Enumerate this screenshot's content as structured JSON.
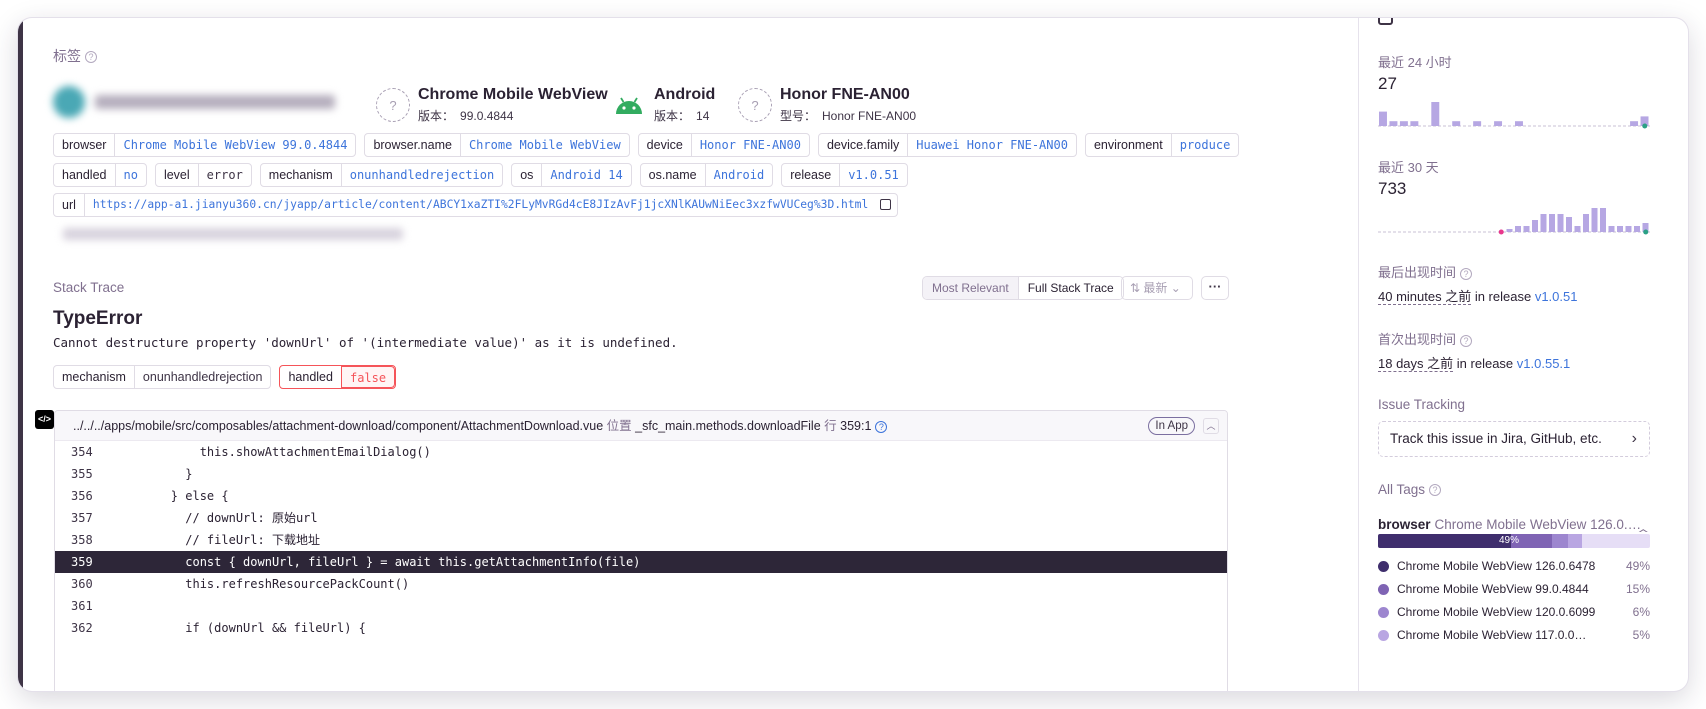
{
  "tags_section": {
    "title": "标签",
    "context": [
      {
        "name": "Chrome Mobile WebView",
        "sub_key": "版本：",
        "sub_val": "99.0.4844",
        "icon": "unknown-icon"
      },
      {
        "name": "Android",
        "sub_key": "版本：",
        "sub_val": "14",
        "icon": "android-icon"
      },
      {
        "name": "Honor FNE-AN00",
        "sub_key": "型号：",
        "sub_val": "Honor FNE-AN00",
        "icon": "unknown-icon"
      }
    ],
    "row1": [
      {
        "k": "browser",
        "v": "Chrome Mobile WebView 99.0.4844"
      },
      {
        "k": "browser.name",
        "v": "Chrome Mobile WebView"
      },
      {
        "k": "device",
        "v": "Honor FNE-AN00"
      },
      {
        "k": "device.family",
        "v": "Huawei Honor FNE-AN00"
      },
      {
        "k": "environment",
        "v": "produce"
      }
    ],
    "row2": [
      {
        "k": "handled",
        "v": "no"
      },
      {
        "k": "level",
        "v": "error"
      },
      {
        "k": "mechanism",
        "v": "onunhandledrejection"
      },
      {
        "k": "os",
        "v": "Android 14"
      },
      {
        "k": "os.name",
        "v": "Android"
      },
      {
        "k": "release",
        "v": "v1.0.51"
      }
    ],
    "url_tag": {
      "k": "url",
      "v": "https://app-a1.jianyu360.cn/jyapp/article/content/ABCY1xaZTI%2FLyMvRGd4cE8JIzAvFj1jcXNlKAUwNiEec3xzfwVUCeg%3D.html"
    }
  },
  "stack": {
    "title": "Stack Trace",
    "toggle": [
      "Most Relevant",
      "Full Stack Trace"
    ],
    "sort_label": "最新",
    "more_label": "···",
    "exception_type": "TypeError",
    "exception_message": "Cannot destructure property 'downUrl' of '(intermediate value)' as it is undefined.",
    "mechanism_tags": [
      {
        "k": "mechanism",
        "v": "onunhandledrejection"
      },
      {
        "k": "handled",
        "v": "false"
      }
    ],
    "code_icon": "</>",
    "frame": {
      "file": "../../../apps/mobile/src/composables/attachment-download/component/AttachmentDownload.vue",
      "at_label": "位置",
      "function": "_sfc_main.methods.downloadFile",
      "line_label": "行",
      "line_pos": "359:1",
      "in_app": "In App",
      "lines": [
        {
          "no": "354",
          "code": "            this.showAttachmentEmailDialog()"
        },
        {
          "no": "355",
          "code": "          }"
        },
        {
          "no": "356",
          "code": "        } else {"
        },
        {
          "no": "357",
          "code": "          // downUrl: 原始url"
        },
        {
          "no": "358",
          "code": "          // fileUrl: 下载地址"
        },
        {
          "no": "359",
          "code": "          const { downUrl, fileUrl } = await this.getAttachmentInfo(file)"
        },
        {
          "no": "360",
          "code": "          this.refreshResourcePackCount()"
        },
        {
          "no": "361",
          "code": ""
        },
        {
          "no": "362",
          "code": "          if (downUrl && fileUrl) {"
        }
      ],
      "highlight_line": "359"
    }
  },
  "sidebar": {
    "last24_title": "最近 24 小时",
    "last24_value": "27",
    "last24_bars": [
      3,
      1,
      1,
      1,
      0,
      5,
      0,
      1,
      0,
      1,
      0,
      1,
      0,
      1,
      0,
      0,
      0,
      0,
      0,
      0,
      0,
      0,
      0,
      0,
      1,
      2
    ],
    "last30_title": "最近 30 天",
    "last30_value": "733",
    "last30_bars": [
      0,
      0,
      0,
      0,
      0,
      0,
      0,
      0,
      0,
      0,
      0,
      0,
      0,
      0,
      0,
      1,
      2,
      2,
      4,
      6,
      6,
      6,
      5,
      2,
      6,
      8,
      8,
      2,
      2,
      2,
      2,
      3
    ],
    "last_seen_title": "最后出现时间",
    "last_seen_time": "40 minutes 之前",
    "in_release": "in release",
    "last_seen_release": "v1.0.51",
    "first_seen_title": "首次出现时间",
    "first_seen_time": "18 days 之前",
    "first_seen_release": "v1.0.55.1",
    "issue_tracking_title": "Issue Tracking",
    "track_label": "Track this issue in Jira, GitHub, etc.",
    "all_tags_title": "All Tags",
    "browser_key": "browser",
    "browser_top": "Chrome Mobile WebView 126.0.…",
    "dist_label": "49%",
    "dist": [
      {
        "name": "Chrome Mobile WebView 126.0.6478",
        "pct": "49%",
        "frac": 0.49,
        "color": "#3f2e6d"
      },
      {
        "name": "Chrome Mobile WebView 99.0.4844",
        "pct": "15%",
        "frac": 0.15,
        "color": "#7f64b4"
      },
      {
        "name": "Chrome Mobile WebView 120.0.6099",
        "pct": "6%",
        "frac": 0.06,
        "color": "#9d86cf"
      },
      {
        "name": "Chrome Mobile WebView 117.0.0…",
        "pct": "5%",
        "frac": 0.05,
        "color": "#b9a6e2"
      }
    ],
    "colors": {
      "bar": "#b6a7e3",
      "baseline": "#c9c2d6",
      "dot_green": "#2ba185",
      "dot_pink": "#e9368c"
    }
  }
}
